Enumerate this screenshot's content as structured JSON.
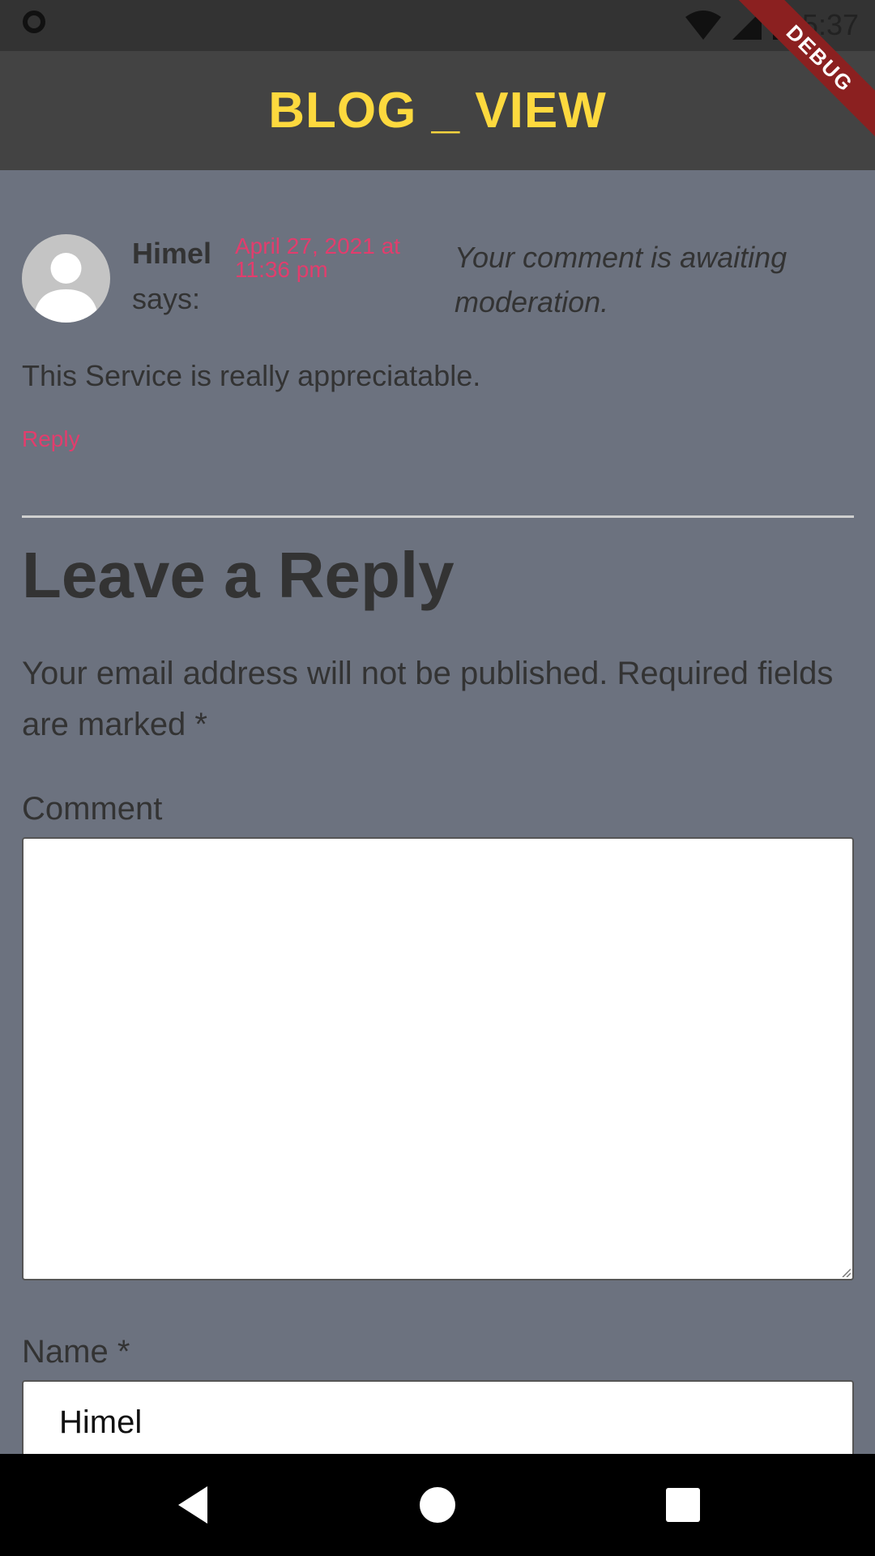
{
  "status_bar": {
    "time": "5:37",
    "icons": [
      "circle-indicator-icon",
      "wifi-icon",
      "signal-icon",
      "battery-icon"
    ]
  },
  "app_bar": {
    "title": "BLOG _ VIEW",
    "debug_label": "DEBUG"
  },
  "comment": {
    "author": "Himel",
    "says": "says:",
    "date": "April 27, 2021 at 11:36 pm",
    "awaiting": "Your comment is awaiting moderation.",
    "text": "This Service is really appreciatable.",
    "reply_label": "Reply"
  },
  "reply_form": {
    "heading": "Leave a Reply",
    "notes": "Your email address will not be published. Required fields are marked *",
    "comment_label": "Comment",
    "comment_value": "",
    "name_label": "Name *",
    "name_value": "Himel"
  },
  "colors": {
    "accent_title": "#fdd93e",
    "link": "#e23d6d",
    "background": "#6c727f",
    "app_bar": "#434343"
  },
  "nav_bar": {
    "icons": [
      "back-icon",
      "home-icon",
      "recents-icon"
    ]
  }
}
